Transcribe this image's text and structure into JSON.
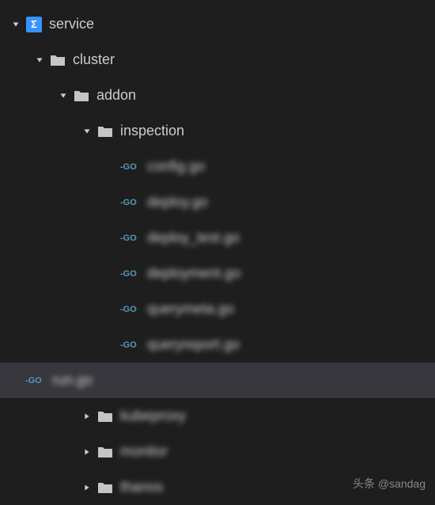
{
  "tree": {
    "service": {
      "label": "service",
      "iconGlyph": "Σ"
    },
    "cluster": {
      "label": "cluster"
    },
    "addon": {
      "label": "addon"
    },
    "inspection": {
      "label": "inspection"
    },
    "files": [
      {
        "label": "config.go",
        "blurred": true
      },
      {
        "label": "deploy.go",
        "blurred": true
      },
      {
        "label": "deploy_test.go",
        "blurred": true
      },
      {
        "label": "deployment.go",
        "blurred": true
      },
      {
        "label": "querymeta.go",
        "blurred": true
      },
      {
        "label": "queryreport.go",
        "blurred": true
      },
      {
        "label": "run.go",
        "blurred": true,
        "selected": true
      }
    ],
    "siblings": [
      {
        "label": "kubeproxy",
        "blurred": true
      },
      {
        "label": "monitor",
        "blurred": true
      },
      {
        "label": "thanos",
        "blurred": true
      }
    ]
  },
  "goBadge": "GO",
  "watermark": "头条 @sandag"
}
